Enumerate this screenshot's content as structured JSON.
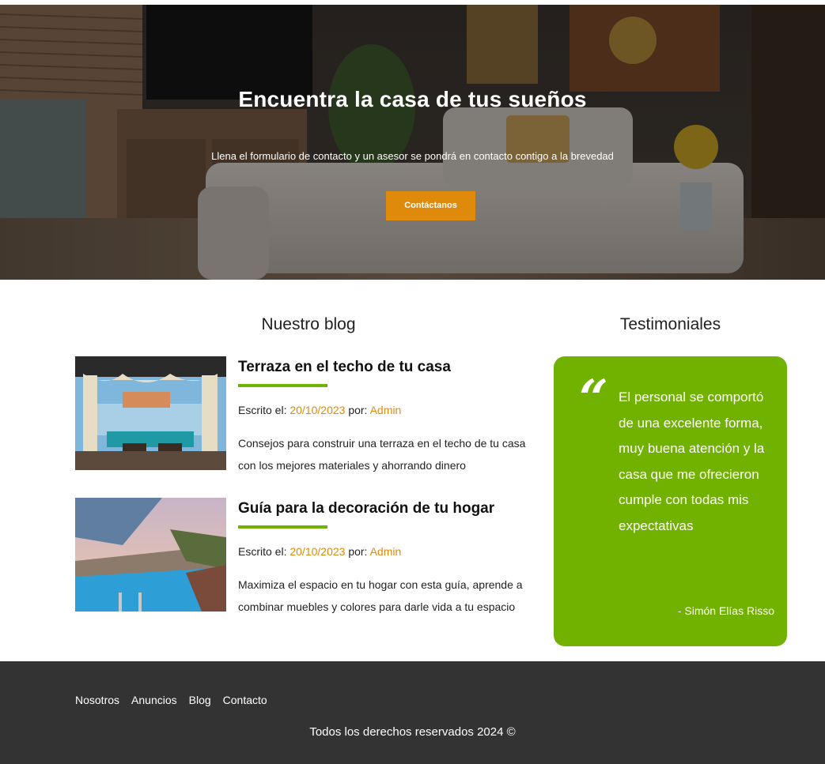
{
  "hero": {
    "title": "Encuentra la casa de tus sueños",
    "subtitle": "Llena el formulario de contacto y un asesor se pondrá en contacto contigo a la brevedad",
    "button_label": "Contáctanos",
    "image": "living-room-photo"
  },
  "blog": {
    "title": "Nuestro blog",
    "entries": [
      {
        "title": "Terraza en el techo de tu casa",
        "meta_prefix": "Escrito el: ",
        "date": "20/10/2023",
        "author_prefix": " por: ",
        "author": "Admin",
        "text": "Consejos para construir una terraza en el techo de tu casa con los mejores materiales y ahorrando dinero",
        "image": "rooftop-terrace-photo"
      },
      {
        "title": "Guía para la decoración de tu hogar",
        "meta_prefix": "Escrito el: ",
        "date": "20/10/2023",
        "author_prefix": " por: ",
        "author": "Admin",
        "text": "Maximiza el espacio en tu hogar con esta guía, aprende a combinar muebles y colores para darle vida a tu espacio",
        "image": "infinity-pool-photo"
      }
    ]
  },
  "testimonials": {
    "title": "Testimoniales",
    "quote_mark": "“",
    "text": "El personal se comportó de una excelente forma, muy buena atención y la casa que me ofrecieron cumple con todas mis expectativas",
    "author": "- Simón Elías Risso"
  },
  "footer": {
    "nav": [
      "Nosotros",
      "Anuncios",
      "Blog",
      "Contacto"
    ],
    "copyright": "Todos los derechos reservados 2024 ©"
  },
  "colors": {
    "accent_orange": "#e08a0b",
    "accent_green": "#71b100",
    "footer_bg": "#333333"
  }
}
